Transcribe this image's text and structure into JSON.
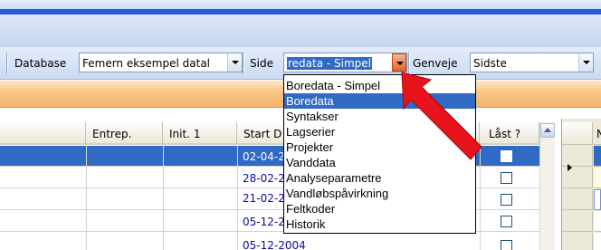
{
  "toolbar": {
    "database_label": "Database",
    "database_value": "Femern eksempel datal",
    "side_label": "Side",
    "side_value": "redata - Simpel",
    "genveje_label": "Genveje",
    "genveje_value": "Sidste"
  },
  "grid": {
    "headers": [
      "Entrep.",
      "Init. 1",
      "Start D",
      "Låst ?"
    ],
    "rows": [
      {
        "date": "02-04-2",
        "selected": true
      },
      {
        "date": "28-02-2",
        "selected": false
      },
      {
        "date": "21-02-2",
        "selected": false
      },
      {
        "date": "05-12-2",
        "selected": false
      },
      {
        "date": "05-12-2004",
        "selected": false
      }
    ],
    "right_header": "N"
  },
  "dropdown": {
    "items": [
      "Boredata - Simpel",
      "Boredata",
      "Syntakser",
      "Lagserier",
      "Projekter",
      "Vanddata",
      "Analyseparametre",
      "Vandløbspåvirkning",
      "Feltkoder",
      "Historik"
    ],
    "highlighted_index": 1
  },
  "colors": {
    "selection": "#316ac5",
    "annotation_arrow": "#e8141b",
    "orange_band": "#f7c386",
    "title_blue": "#245dd6"
  },
  "icons": [
    "chevron-down-icon",
    "scroll-up-icon",
    "row-pointer-icon",
    "red-annotation-arrow"
  ]
}
